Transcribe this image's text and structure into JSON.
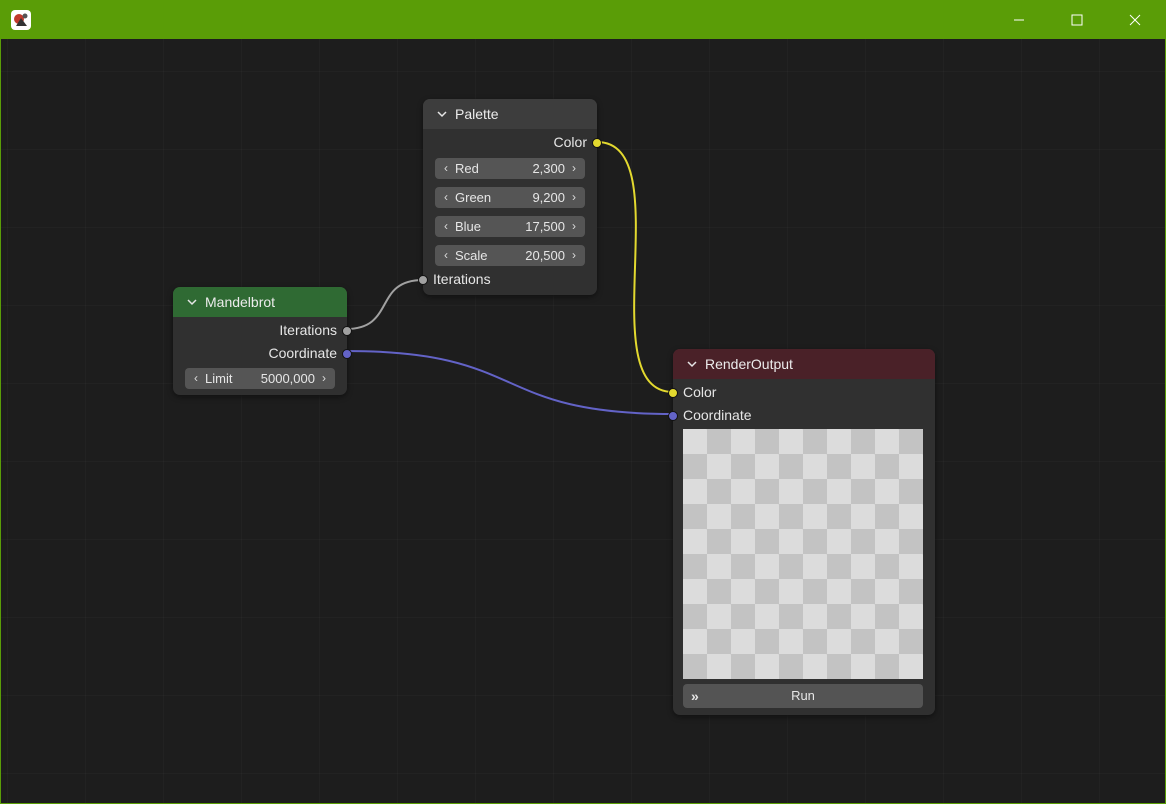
{
  "window": {
    "app_icon": "app-logo-icon",
    "controls": [
      "minimize-icon",
      "maximize-icon",
      "close-icon"
    ],
    "titlebar_color": "#5a9d07"
  },
  "nodes": {
    "mandelbrot": {
      "title": "Mandelbrot",
      "header_color": "#2f6a33",
      "outputs": {
        "iterations": "Iterations",
        "coordinate": "Coordinate"
      },
      "limit": {
        "label": "Limit",
        "value": "5000,000"
      }
    },
    "palette": {
      "title": "Palette",
      "header_color": "#3d3d3d",
      "outputs": {
        "color": "Color"
      },
      "fields": [
        {
          "label": "Red",
          "value": "2,300"
        },
        {
          "label": "Green",
          "value": "9,200"
        },
        {
          "label": "Blue",
          "value": "17,500"
        },
        {
          "label": "Scale",
          "value": "20,500"
        }
      ],
      "inputs": {
        "iterations": "Iterations"
      }
    },
    "render_output": {
      "title": "RenderOutput",
      "header_color": "#4a2128",
      "inputs": {
        "color": "Color",
        "coordinate": "Coordinate"
      },
      "run_label": "Run",
      "run_icon": "fast-forward-icon"
    }
  },
  "socket_colors": {
    "gray": "#a1a1a1",
    "yellow": "#e3d92f",
    "purple": "#6363c7"
  }
}
